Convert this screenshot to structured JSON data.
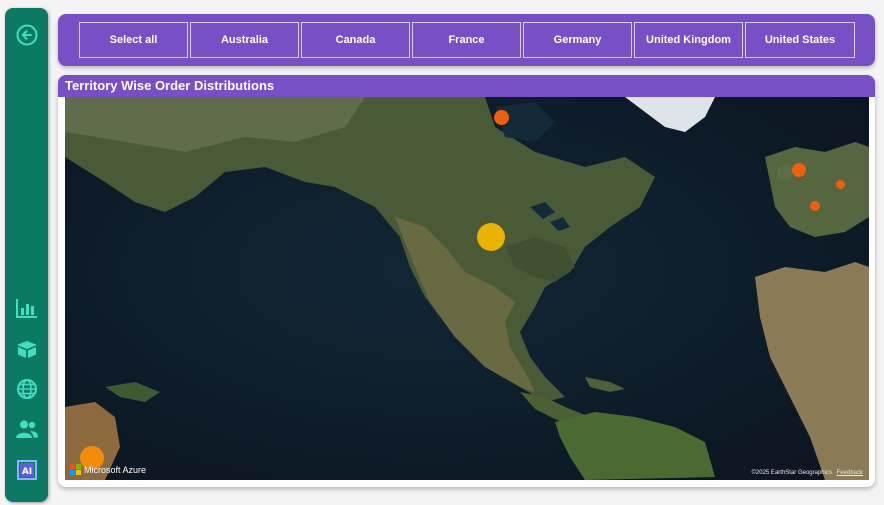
{
  "nav": {
    "items": [
      {
        "icon": "back-arrow-icon"
      },
      {
        "icon": "bar-chart-icon"
      },
      {
        "icon": "box-icon"
      },
      {
        "icon": "globe-icon"
      },
      {
        "icon": "users-icon"
      },
      {
        "icon": "ai-icon"
      }
    ]
  },
  "slicer": {
    "options": [
      "Select all",
      "Australia",
      "Canada",
      "France",
      "Germany",
      "United Kingdom",
      "United States"
    ]
  },
  "map": {
    "title": "Territory Wise Order Distributions",
    "provider": "Microsoft Azure",
    "copyright": "©2025 EarthStar Geographics",
    "feedback": "Feedback",
    "bubbles": [
      {
        "territory": "United States",
        "color": "#e8b400"
      },
      {
        "territory": "Canada",
        "color": "#f0600a"
      },
      {
        "territory": "United Kingdom",
        "color": "#f0600a"
      },
      {
        "territory": "Germany",
        "color": "#f0600a"
      },
      {
        "territory": "France",
        "color": "#f0600a"
      },
      {
        "territory": "Australia",
        "color": "#f08c0a"
      }
    ]
  },
  "colors": {
    "rail": "#0c7a62",
    "accent": "#7650c4",
    "icon": "#3fe0c0"
  }
}
